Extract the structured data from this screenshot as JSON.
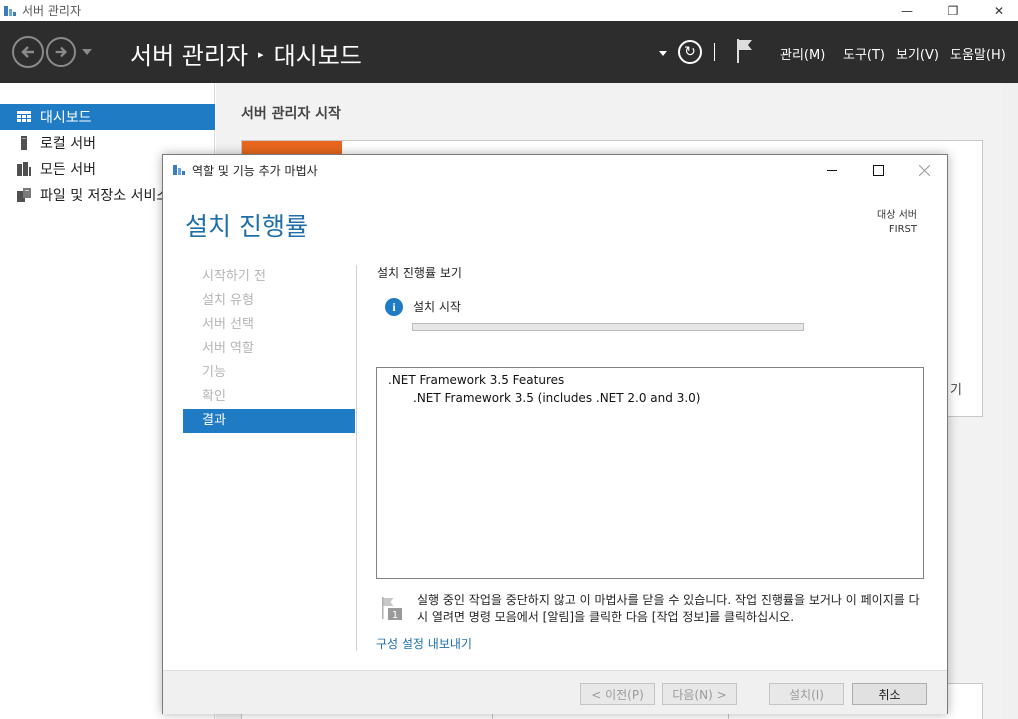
{
  "window": {
    "title": "서버 관리자",
    "minimize": "—",
    "restore": "❐",
    "close": "✕"
  },
  "header": {
    "breadcrumb_root": "서버 관리자",
    "breadcrumb_sep": "▸",
    "breadcrumb_current": "대시보드",
    "menus": {
      "manage": "관리(M)",
      "tools": "도구(T)",
      "view": "보기(V)",
      "help": "도움말(H)"
    }
  },
  "sidebar": {
    "items": [
      {
        "label": "대시보드",
        "icon": "dashboard-icon",
        "active": true
      },
      {
        "label": "로컬 서버",
        "icon": "local-server-icon",
        "active": false
      },
      {
        "label": "모든 서버",
        "icon": "all-servers-icon",
        "active": false
      },
      {
        "label": "파일 및 저장소 서비스",
        "icon": "file-storage-icon",
        "active": false
      }
    ]
  },
  "dashboard": {
    "title": "서버 관리자 시작",
    "more_suffix": "기"
  },
  "wizard": {
    "title": "역할 및 기능 추가 마법사",
    "heading": "설치 진행률",
    "target_label": "대상 서버",
    "target_name": "FIRST",
    "steps": [
      {
        "label": "시작하기 전",
        "active": false
      },
      {
        "label": "설치 유형",
        "active": false
      },
      {
        "label": "서버 선택",
        "active": false
      },
      {
        "label": "서버 역할",
        "active": false
      },
      {
        "label": "기능",
        "active": false
      },
      {
        "label": "확인",
        "active": false
      },
      {
        "label": "결과",
        "active": true
      }
    ],
    "progress_title": "설치 진행률 보기",
    "status": "설치 시작",
    "progress": 0,
    "features": [
      {
        "label": ".NET Framework 3.5 Features",
        "level": 0
      },
      {
        "label": ".NET Framework 3.5 (includes .NET 2.0 and 3.0)",
        "level": 1
      }
    ],
    "notice_badge": "1",
    "notice": "실행 중인 작업을 중단하지 않고 이 마법사를 닫을 수 있습니다. 작업 진행률을 보거나 이 페이지를 다시 열려면 명령 모음에서 [알림]을 클릭한 다음 [작업 정보]를 클릭하십시오.",
    "export_link": "구성 설정 내보내기",
    "buttons": {
      "previous": "< 이전(P)",
      "next": "다음(N) >",
      "install": "설치(I)",
      "cancel": "취소"
    }
  },
  "colors": {
    "accent": "#1f7bc4",
    "header_bg": "#2d2d2d",
    "tile_orange": "#e8661e",
    "link": "#1e6ea8"
  }
}
